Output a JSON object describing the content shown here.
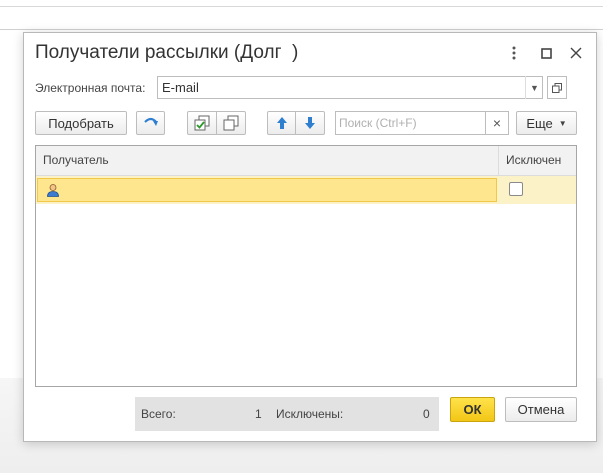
{
  "dialog": {
    "title": "Получатели рассылки (Долг  )",
    "email": {
      "label": "Электронная почта:",
      "value": "E-mail"
    },
    "toolbar": {
      "pick_label": "Подобрать",
      "search_placeholder": "Поиск (Ctrl+F)",
      "clear_symbol": "×",
      "more_label": "Еще"
    },
    "table": {
      "columns": [
        "Получатель",
        "Исключен"
      ],
      "rows": [
        {
          "recipient": "",
          "excluded": false,
          "selected": true
        }
      ]
    },
    "summary": {
      "total_label": "Всего:",
      "total_value": "1",
      "excluded_label": "Исключены:",
      "excluded_value": "0"
    },
    "buttons": {
      "ok": "ОК",
      "cancel": "Отмена"
    }
  },
  "icons": [
    "more-vertical-icon",
    "maximize-icon",
    "close-icon",
    "dropdown-icon",
    "open-icon",
    "move-arrow-icon",
    "check-all-icon",
    "copy-icon",
    "arrow-up-icon",
    "arrow-down-icon",
    "user-icon"
  ],
  "colors": {
    "accent_ok": "#f5cd1f",
    "row_selected": "#fde68e",
    "arrow_blue": "#2f7fd0"
  }
}
